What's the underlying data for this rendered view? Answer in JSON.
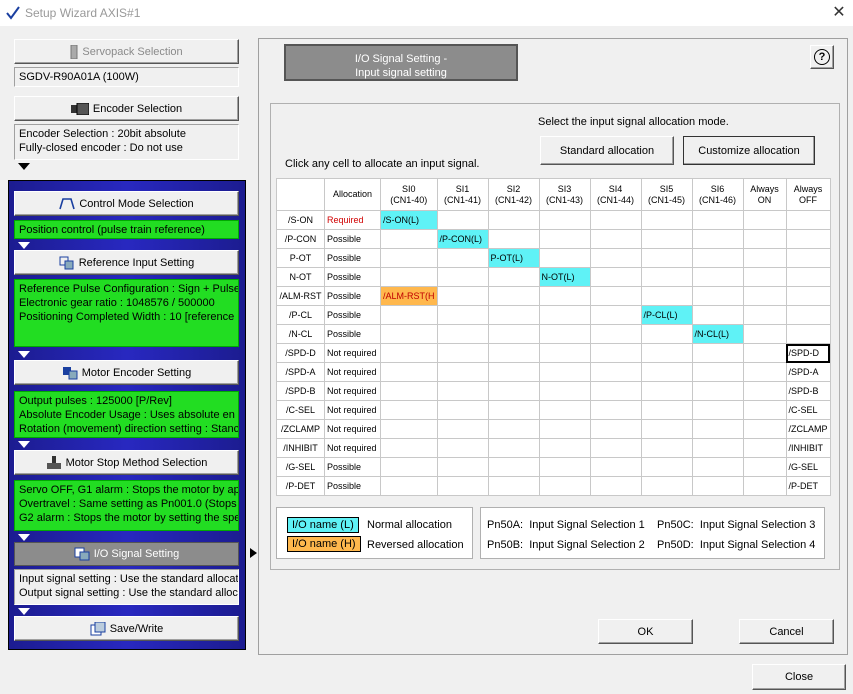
{
  "window": {
    "title": "Setup Wizard AXIS#1"
  },
  "left": {
    "servopack_button": "Servopack Selection",
    "servopack_model": "SGDV-R90A01A (100W)",
    "encoder_button": "Encoder Selection",
    "encoder_info": [
      "Encoder Selection : 20bit absolute",
      "Fully-closed encoder : Do not use"
    ],
    "control_button": "Control Mode Selection",
    "control_info": [
      "Position control (pulse train reference)"
    ],
    "reference_button": "Reference Input Setting",
    "reference_info": [
      "Reference Pulse Configuration : Sign + Pulse",
      "Electronic gear ratio : 1048576 / 500000",
      "Positioning Completed Width : 10 [reference"
    ],
    "motor_encoder_button": "Motor Encoder Setting",
    "motor_encoder_info": [
      "Output pulses : 125000 [P/Rev]",
      "Absolute Encoder Usage : Uses absolute en",
      "Rotation (movement) direction setting : Stanc"
    ],
    "motor_stop_button": "Motor Stop Method Selection",
    "motor_stop_info": [
      "Servo OFF, G1 alarm : Stops the motor by ap",
      "Overtravel : Same setting as Pn001.0 (Stops",
      "G2 alarm : Stops the motor by setting the spe"
    ],
    "io_button": "I/O Signal Setting",
    "io_info": [
      "Input signal setting : Use the standard allocat",
      "Output signal setting : Use the standard alloc"
    ],
    "save_button": "Save/Write"
  },
  "right": {
    "header_line1": "I/O Signal Setting -",
    "header_line2": "Input signal setting",
    "help": "?",
    "mode_prompt": "Select the input signal allocation mode.",
    "standard_button": "Standard allocation",
    "custom_button": "Customize allocation",
    "click_prompt": "Click any cell to allocate an input signal.",
    "columns": [
      {
        "l1": "Allocation",
        "l2": ""
      },
      {
        "l1": "SI0",
        "l2": "(CN1-40)"
      },
      {
        "l1": "SI1",
        "l2": "(CN1-41)"
      },
      {
        "l1": "SI2",
        "l2": "(CN1-42)"
      },
      {
        "l1": "SI3",
        "l2": "(CN1-43)"
      },
      {
        "l1": "SI4",
        "l2": "(CN1-44)"
      },
      {
        "l1": "SI5",
        "l2": "(CN1-45)"
      },
      {
        "l1": "SI6",
        "l2": "(CN1-46)"
      },
      {
        "l1": "Always",
        "l2": "ON"
      },
      {
        "l1": "Always",
        "l2": "OFF"
      }
    ],
    "rows": [
      {
        "name": "/S-ON",
        "alloc": "Required",
        "col": 1,
        "text": "/S-ON(L)",
        "kind": "cyan"
      },
      {
        "name": "/P-CON",
        "alloc": "Possible",
        "col": 2,
        "text": "/P-CON(L)",
        "kind": "cyan"
      },
      {
        "name": "P-OT",
        "alloc": "Possible",
        "col": 3,
        "text": "P-OT(L)",
        "kind": "cyan"
      },
      {
        "name": "N-OT",
        "alloc": "Possible",
        "col": 4,
        "text": "N-OT(L)",
        "kind": "cyan"
      },
      {
        "name": "/ALM-RST",
        "alloc": "Possible",
        "col": 1,
        "text": "/ALM-RST(H",
        "kind": "orange"
      },
      {
        "name": "/P-CL",
        "alloc": "Possible",
        "col": 6,
        "text": "/P-CL(L)",
        "kind": "cyan"
      },
      {
        "name": "/N-CL",
        "alloc": "Possible",
        "col": 7,
        "text": "/N-CL(L)",
        "kind": "cyan"
      },
      {
        "name": "/SPD-D",
        "alloc": "Not required",
        "col": 9,
        "text": "/SPD-D",
        "kind": "sel"
      },
      {
        "name": "/SPD-A",
        "alloc": "Not required",
        "col": 9,
        "text": "/SPD-A",
        "kind": "plain"
      },
      {
        "name": "/SPD-B",
        "alloc": "Not required",
        "col": 9,
        "text": "/SPD-B",
        "kind": "plain"
      },
      {
        "name": "/C-SEL",
        "alloc": "Not required",
        "col": 9,
        "text": "/C-SEL",
        "kind": "plain"
      },
      {
        "name": "/ZCLAMP",
        "alloc": "Not required",
        "col": 9,
        "text": "/ZCLAMP",
        "kind": "plain"
      },
      {
        "name": "/INHIBIT",
        "alloc": "Not required",
        "col": 9,
        "text": "/INHIBIT",
        "kind": "plain"
      },
      {
        "name": "/G-SEL",
        "alloc": "Possible",
        "col": 9,
        "text": "/G-SEL",
        "kind": "plain"
      },
      {
        "name": "/P-DET",
        "alloc": "Possible",
        "col": 9,
        "text": "/P-DET",
        "kind": "plain"
      }
    ],
    "legend": {
      "normal_swatch": "I/O name (L)",
      "normal_label": "Normal allocation",
      "reversed_swatch": "I/O name (H)",
      "reversed_label": "Reversed allocation"
    },
    "params": [
      {
        "code": "Pn50A:",
        "label": "Input Signal Selection 1"
      },
      {
        "code": "Pn50C:",
        "label": "Input Signal Selection 3"
      },
      {
        "code": "Pn50B:",
        "label": "Input Signal Selection 2"
      },
      {
        "code": "Pn50D:",
        "label": "Input Signal Selection 4"
      }
    ],
    "ok_button": "OK",
    "cancel_button": "Cancel"
  },
  "close_button": "Close",
  "colors": {
    "normal": "#5ff2f6",
    "reversed": "#ffb84d",
    "green": "#22dd22",
    "panel": "#2020a0"
  }
}
